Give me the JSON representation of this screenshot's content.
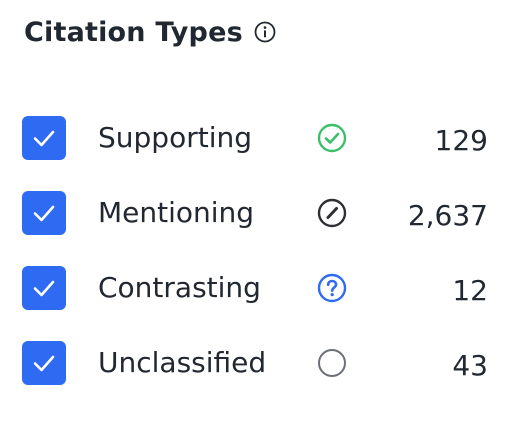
{
  "filter": {
    "title": "Citation Types",
    "info_icon": "info-icon",
    "accent_color": "#2f6bf2",
    "items": [
      {
        "label": "Supporting",
        "count": "129",
        "checked": true,
        "icon": "check-circle-icon",
        "icon_color": "#3cbf6a"
      },
      {
        "label": "Mentioning",
        "count": "2,637",
        "checked": true,
        "icon": "slash-circle-icon",
        "icon_color": "#2d2f33"
      },
      {
        "label": "Contrasting",
        "count": "12",
        "checked": true,
        "icon": "question-circle-icon",
        "icon_color": "#2f6bf2"
      },
      {
        "label": "Unclassified",
        "count": "43",
        "checked": true,
        "icon": "empty-circle-icon",
        "icon_color": "#6b6f76"
      }
    ]
  }
}
